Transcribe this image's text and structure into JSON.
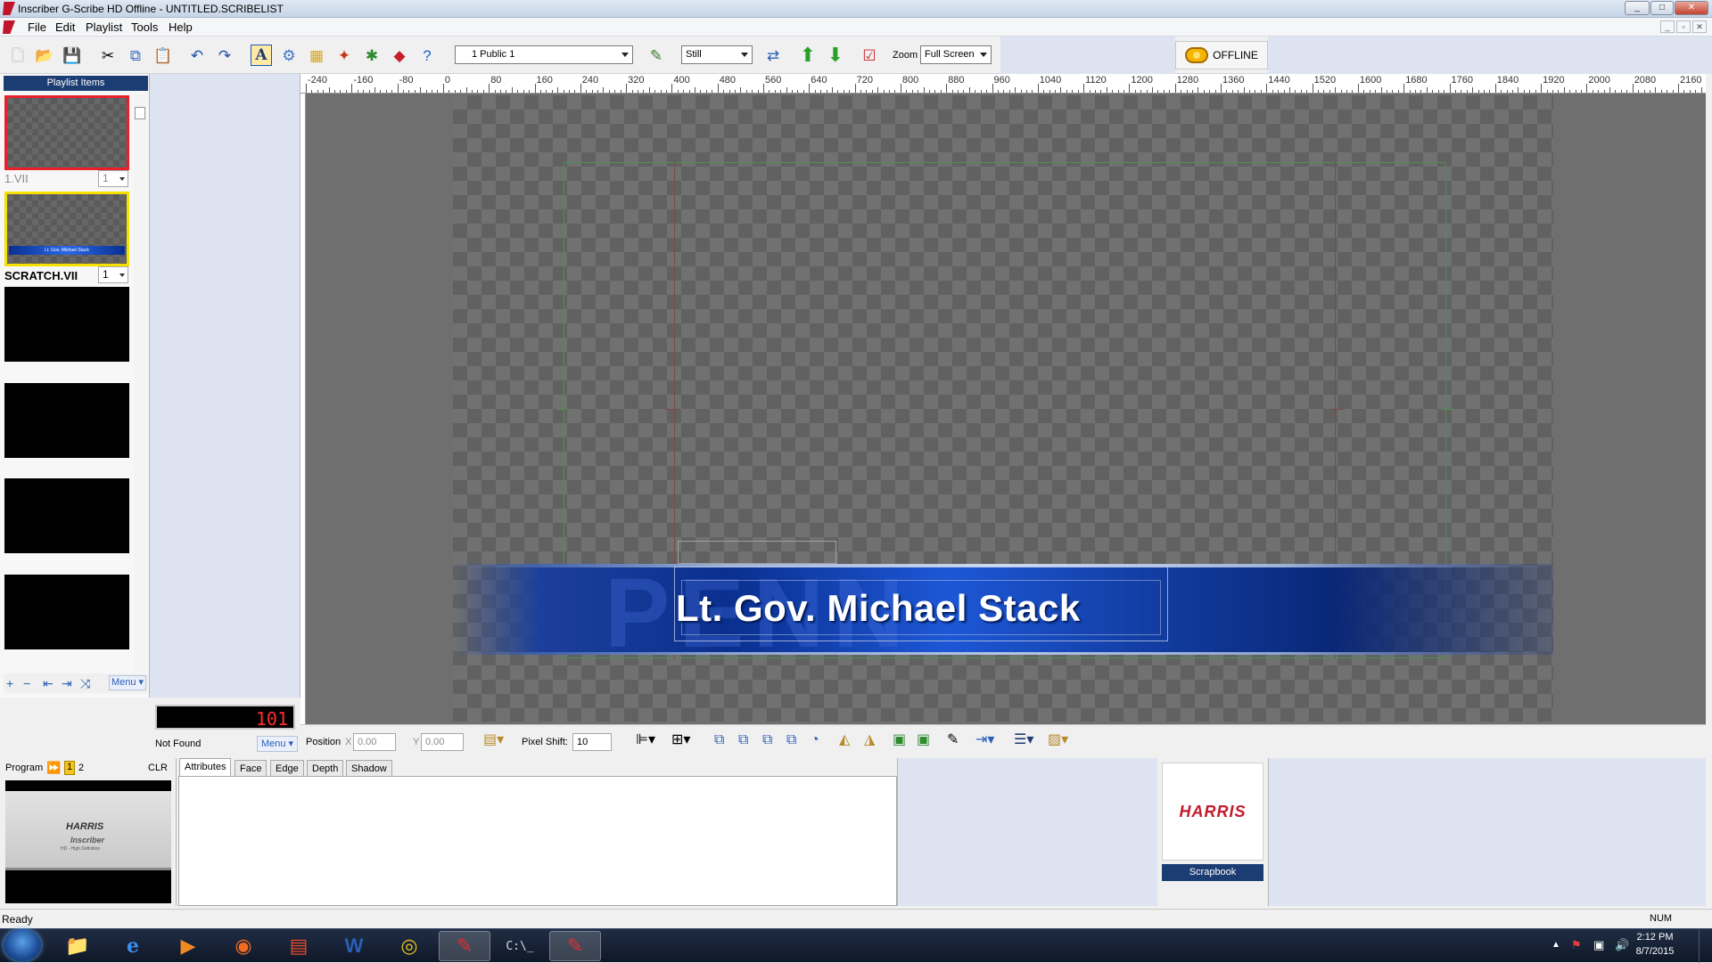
{
  "window": {
    "title": "Inscriber G-Scribe HD Offline - UNTITLED.SCRIBELIST",
    "min": "_",
    "max": "□",
    "close": "✕"
  },
  "menu": {
    "items": [
      "File",
      "Edit",
      "Playlist",
      "Tools",
      "Help"
    ]
  },
  "toolbar": {
    "channel_select": "1 Public 1",
    "mode_select": "Still",
    "zoom_label": "Zoom",
    "zoom_select": "Full Screen",
    "offline_label": "OFFLINE"
  },
  "ruler": {
    "labels": [
      "-240",
      "-160",
      "-80",
      "0",
      "80",
      "160",
      "240",
      "320",
      "400",
      "480",
      "560",
      "640",
      "720",
      "800",
      "880",
      "960",
      "1040",
      "1120",
      "1200",
      "1280",
      "1360",
      "1440",
      "1520",
      "1600",
      "1680",
      "1760",
      "1840",
      "1920",
      "2000",
      "2080",
      "2160"
    ]
  },
  "playlist": {
    "header": "Playlist Items",
    "items": [
      {
        "name": "1.VII",
        "num": "1"
      },
      {
        "name": "SCRATCH.VII",
        "num": "1"
      }
    ],
    "thumb_caption": "Lt. Gov. Michael Stack",
    "menu": "Menu ▾"
  },
  "counter": {
    "value": "101",
    "status": "Not Found",
    "menu": "Menu ▾"
  },
  "graphic": {
    "text": "Lt. Gov. Michael Stack",
    "bg_text": "PENN"
  },
  "position": {
    "label": "Position",
    "x_label": "X",
    "x": "0.00",
    "y_label": "Y",
    "y": "0.00",
    "pixel_shift_label": "Pixel Shift:",
    "pixel_shift": "10"
  },
  "program": {
    "label": "Program",
    "ch1": "1",
    "ch2": "2",
    "clr": "CLR",
    "thumb_brand": "HARRIS",
    "thumb_product": "Inscriber",
    "thumb_sub": "HD - High Definition"
  },
  "tabs": [
    "Attributes",
    "Face",
    "Edge",
    "Depth",
    "Shadow"
  ],
  "scrapbook": {
    "label": "Scrapbook",
    "brand": "HARRIS"
  },
  "status": {
    "text": "Ready",
    "num": "NUM"
  },
  "taskbar": {
    "time": "2:12 PM",
    "date": "8/7/2015"
  },
  "colors": {
    "accent": "#1c3d73",
    "selected_red": "#e8202a",
    "selected_yellow": "#f5e000",
    "counter": "#ff2d2d"
  }
}
